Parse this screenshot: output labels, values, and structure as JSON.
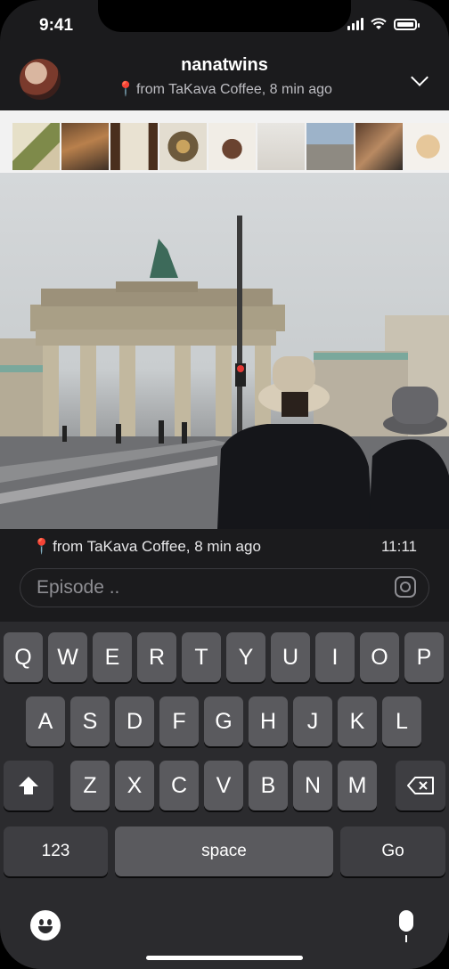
{
  "status_bar": {
    "time": "9:41"
  },
  "header": {
    "username": "nanatwins",
    "subtitle": "from TaKava Coffee, 8 min ago"
  },
  "post": {
    "location": "from TaKava Coffee, 8 min ago",
    "time": "11:11"
  },
  "composer": {
    "placeholder": "Episode .."
  },
  "keyboard": {
    "row1": [
      "Q",
      "W",
      "E",
      "R",
      "T",
      "Y",
      "U",
      "I",
      "O",
      "P"
    ],
    "row2": [
      "A",
      "S",
      "D",
      "F",
      "G",
      "H",
      "J",
      "K",
      "L"
    ],
    "row3": [
      "Z",
      "X",
      "C",
      "V",
      "B",
      "N",
      "M"
    ],
    "numbers_label": "123",
    "space_label": "space",
    "go_label": "Go"
  },
  "icons": {
    "location": "pin-icon",
    "expand": "chevron-down-icon",
    "instagram": "instagram-icon",
    "emoji": "emoji-icon",
    "mic": "microphone-icon",
    "shift": "shift-icon",
    "delete": "backspace-icon"
  },
  "colors": {
    "background": "#1b1b1d",
    "keyboard": "#2b2b2e",
    "key": "#5a5a5e",
    "pin": "#e53935"
  }
}
